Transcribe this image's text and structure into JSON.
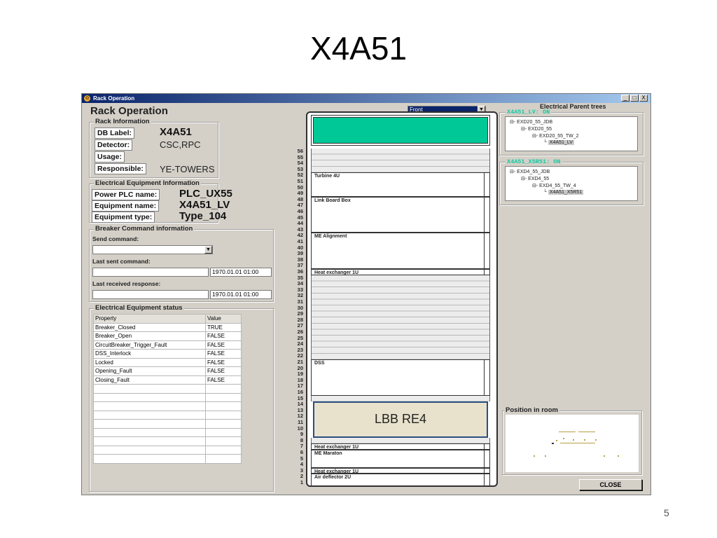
{
  "slide": {
    "title": "X4A51",
    "page_number": "5"
  },
  "window": {
    "title": "Rack Operation",
    "heading": "Rack Operation",
    "controls": [
      "_",
      "□",
      "X"
    ]
  },
  "rack_info": {
    "legend": "Rack Information",
    "db_label_label": "DB Label:",
    "db_label_value": "X4A51",
    "detector_label": "Detector:",
    "detector_value": "CSC,RPC",
    "usage_label": "Usage:",
    "usage_value": "",
    "responsible_label": "Responsible:",
    "responsible_value": "YE-TOWERS"
  },
  "equipment_info": {
    "legend": "Electrical Equipment Information",
    "power_plc_label": "Power PLC name:",
    "power_plc_value": "PLC_UX55",
    "equipment_name_label": "Equipment name:",
    "equipment_name_value": "X4A51_LV",
    "equipment_type_label": "Equipment type:",
    "equipment_type_value": "Type_104"
  },
  "breaker": {
    "legend": "Breaker Command information",
    "send_label": "Send command:",
    "send_value": "",
    "last_sent_label": "Last sent command:",
    "last_sent_value": "",
    "last_sent_time": "1970.01.01 01:00",
    "last_received_label": "Last received response:",
    "last_received_value": "",
    "last_received_time": "1970.01.01 01:00"
  },
  "status": {
    "legend": "Electrical Equipment status",
    "columns": [
      "Property",
      "Value"
    ],
    "rows": [
      [
        "Breaker_Closed",
        "TRUE"
      ],
      [
        "Breaker_Open",
        "FALSE"
      ],
      [
        "CircuitBreaker_Trigger_Fault",
        "FALSE"
      ],
      [
        "DSS_Interlock",
        "FALSE"
      ],
      [
        "Locked",
        "FALSE"
      ],
      [
        "Opening_Fault",
        "FALSE"
      ],
      [
        "Closing_Fault",
        "FALSE"
      ],
      [
        "",
        ""
      ],
      [
        "",
        ""
      ],
      [
        "",
        ""
      ],
      [
        "",
        ""
      ],
      [
        "",
        ""
      ],
      [
        "",
        ""
      ],
      [
        "",
        ""
      ],
      [
        "",
        ""
      ],
      [
        "",
        ""
      ]
    ]
  },
  "rack_view": {
    "view_select": "Front",
    "units": [
      "56",
      "55",
      "54",
      "53",
      "52",
      "51",
      "50",
      "49",
      "48",
      "47",
      "46",
      "45",
      "44",
      "43",
      "42",
      "41",
      "40",
      "39",
      "38",
      "37",
      "36",
      "35",
      "34",
      "33",
      "32",
      "31",
      "30",
      "29",
      "28",
      "27",
      "26",
      "25",
      "24",
      "23",
      "22",
      "21",
      "20",
      "19",
      "18",
      "17",
      "16",
      "15",
      "14",
      "13",
      "12",
      "11",
      "10",
      "9",
      "8",
      "7",
      "6",
      "5",
      "4",
      "3",
      "2",
      "1"
    ],
    "slots": [
      "Turbine 4U",
      "Link Board Box",
      "ME Alignment",
      "Heat exchanger 1U",
      "DSS",
      "LBB RE4",
      "Heat exchanger 1U",
      "ME Maraton",
      "Heat exchanger 1U",
      "Air deflector 2U"
    ],
    "top_color": "#00c896",
    "lbb_color": "#e8e2cc"
  },
  "parent_trees": {
    "heading": "Electrical Parent trees",
    "tree1": {
      "legend": "X4A51_LV: ON",
      "nodes": [
        "EXD20_55_JDB",
        "EXD20_55",
        "EXD20_55_TW_2",
        "X4A51_LV"
      ]
    },
    "tree2": {
      "legend": "X4A51_X5R51: ON",
      "nodes": [
        "EXD4_55_JDB",
        "EXD4_55",
        "EXD4_55_TW_4",
        "X4A51_X5R51"
      ]
    },
    "legend_color": "#14c8a0"
  },
  "room": {
    "legend": "Position in room"
  },
  "close_button": "CLOSE"
}
